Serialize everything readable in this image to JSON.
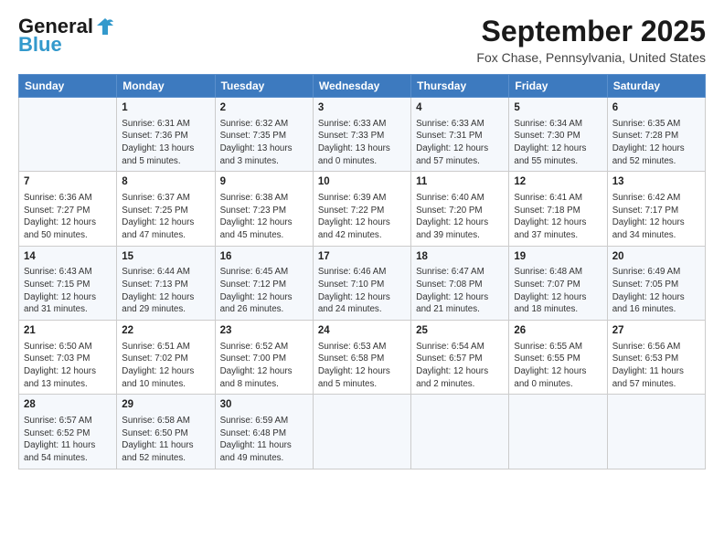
{
  "logo": {
    "general": "General",
    "blue": "Blue"
  },
  "title": "September 2025",
  "location": "Fox Chase, Pennsylvania, United States",
  "days_header": [
    "Sunday",
    "Monday",
    "Tuesday",
    "Wednesday",
    "Thursday",
    "Friday",
    "Saturday"
  ],
  "weeks": [
    [
      {
        "day": "",
        "content": ""
      },
      {
        "day": "1",
        "content": "Sunrise: 6:31 AM\nSunset: 7:36 PM\nDaylight: 13 hours\nand 5 minutes."
      },
      {
        "day": "2",
        "content": "Sunrise: 6:32 AM\nSunset: 7:35 PM\nDaylight: 13 hours\nand 3 minutes."
      },
      {
        "day": "3",
        "content": "Sunrise: 6:33 AM\nSunset: 7:33 PM\nDaylight: 13 hours\nand 0 minutes."
      },
      {
        "day": "4",
        "content": "Sunrise: 6:33 AM\nSunset: 7:31 PM\nDaylight: 12 hours\nand 57 minutes."
      },
      {
        "day": "5",
        "content": "Sunrise: 6:34 AM\nSunset: 7:30 PM\nDaylight: 12 hours\nand 55 minutes."
      },
      {
        "day": "6",
        "content": "Sunrise: 6:35 AM\nSunset: 7:28 PM\nDaylight: 12 hours\nand 52 minutes."
      }
    ],
    [
      {
        "day": "7",
        "content": "Sunrise: 6:36 AM\nSunset: 7:27 PM\nDaylight: 12 hours\nand 50 minutes."
      },
      {
        "day": "8",
        "content": "Sunrise: 6:37 AM\nSunset: 7:25 PM\nDaylight: 12 hours\nand 47 minutes."
      },
      {
        "day": "9",
        "content": "Sunrise: 6:38 AM\nSunset: 7:23 PM\nDaylight: 12 hours\nand 45 minutes."
      },
      {
        "day": "10",
        "content": "Sunrise: 6:39 AM\nSunset: 7:22 PM\nDaylight: 12 hours\nand 42 minutes."
      },
      {
        "day": "11",
        "content": "Sunrise: 6:40 AM\nSunset: 7:20 PM\nDaylight: 12 hours\nand 39 minutes."
      },
      {
        "day": "12",
        "content": "Sunrise: 6:41 AM\nSunset: 7:18 PM\nDaylight: 12 hours\nand 37 minutes."
      },
      {
        "day": "13",
        "content": "Sunrise: 6:42 AM\nSunset: 7:17 PM\nDaylight: 12 hours\nand 34 minutes."
      }
    ],
    [
      {
        "day": "14",
        "content": "Sunrise: 6:43 AM\nSunset: 7:15 PM\nDaylight: 12 hours\nand 31 minutes."
      },
      {
        "day": "15",
        "content": "Sunrise: 6:44 AM\nSunset: 7:13 PM\nDaylight: 12 hours\nand 29 minutes."
      },
      {
        "day": "16",
        "content": "Sunrise: 6:45 AM\nSunset: 7:12 PM\nDaylight: 12 hours\nand 26 minutes."
      },
      {
        "day": "17",
        "content": "Sunrise: 6:46 AM\nSunset: 7:10 PM\nDaylight: 12 hours\nand 24 minutes."
      },
      {
        "day": "18",
        "content": "Sunrise: 6:47 AM\nSunset: 7:08 PM\nDaylight: 12 hours\nand 21 minutes."
      },
      {
        "day": "19",
        "content": "Sunrise: 6:48 AM\nSunset: 7:07 PM\nDaylight: 12 hours\nand 18 minutes."
      },
      {
        "day": "20",
        "content": "Sunrise: 6:49 AM\nSunset: 7:05 PM\nDaylight: 12 hours\nand 16 minutes."
      }
    ],
    [
      {
        "day": "21",
        "content": "Sunrise: 6:50 AM\nSunset: 7:03 PM\nDaylight: 12 hours\nand 13 minutes."
      },
      {
        "day": "22",
        "content": "Sunrise: 6:51 AM\nSunset: 7:02 PM\nDaylight: 12 hours\nand 10 minutes."
      },
      {
        "day": "23",
        "content": "Sunrise: 6:52 AM\nSunset: 7:00 PM\nDaylight: 12 hours\nand 8 minutes."
      },
      {
        "day": "24",
        "content": "Sunrise: 6:53 AM\nSunset: 6:58 PM\nDaylight: 12 hours\nand 5 minutes."
      },
      {
        "day": "25",
        "content": "Sunrise: 6:54 AM\nSunset: 6:57 PM\nDaylight: 12 hours\nand 2 minutes."
      },
      {
        "day": "26",
        "content": "Sunrise: 6:55 AM\nSunset: 6:55 PM\nDaylight: 12 hours\nand 0 minutes."
      },
      {
        "day": "27",
        "content": "Sunrise: 6:56 AM\nSunset: 6:53 PM\nDaylight: 11 hours\nand 57 minutes."
      }
    ],
    [
      {
        "day": "28",
        "content": "Sunrise: 6:57 AM\nSunset: 6:52 PM\nDaylight: 11 hours\nand 54 minutes."
      },
      {
        "day": "29",
        "content": "Sunrise: 6:58 AM\nSunset: 6:50 PM\nDaylight: 11 hours\nand 52 minutes."
      },
      {
        "day": "30",
        "content": "Sunrise: 6:59 AM\nSunset: 6:48 PM\nDaylight: 11 hours\nand 49 minutes."
      },
      {
        "day": "",
        "content": ""
      },
      {
        "day": "",
        "content": ""
      },
      {
        "day": "",
        "content": ""
      },
      {
        "day": "",
        "content": ""
      }
    ]
  ]
}
